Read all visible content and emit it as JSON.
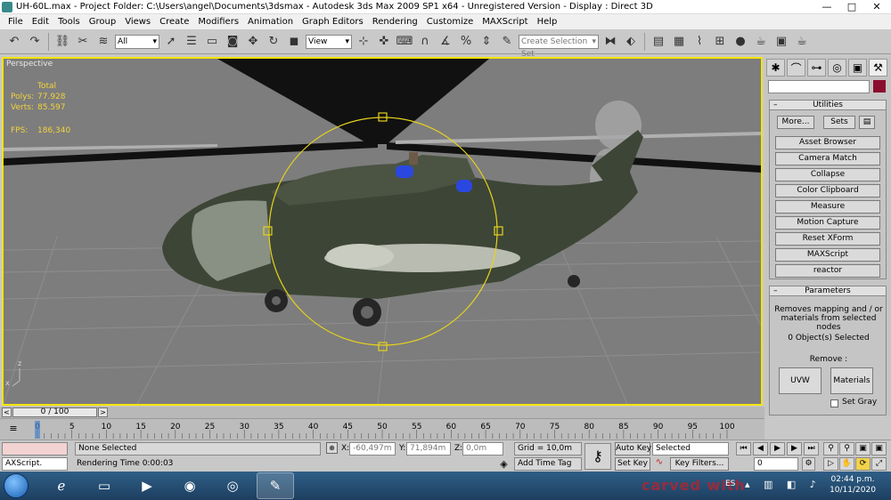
{
  "window": {
    "title": "UH-60L.max    - Project Folder: C:\\Users\\angel\\Documents\\3dsmax    - Autodesk 3ds Max  2009 SP1  x64    - Unregistered Version    - Display : Direct 3D",
    "buttons": [
      "—",
      "□",
      "✕"
    ]
  },
  "menu": [
    "File",
    "Edit",
    "Tools",
    "Group",
    "Views",
    "Create",
    "Modifiers",
    "Animation",
    "Graph Editors",
    "Rendering",
    "Customize",
    "MAXScript",
    "Help"
  ],
  "toolbar": {
    "selection_filter": "All",
    "reference_coord": "View",
    "named_selection_placeholder": "Create Selection Set",
    "icons": [
      "undo-icon",
      "redo-icon",
      "link-icon",
      "unlink-icon",
      "bind-space-warp-icon",
      "select-icon",
      "select-by-name-icon",
      "rect-region-icon",
      "window-crossing-icon",
      "move-icon",
      "rotate-icon",
      "scale-icon",
      "pivot-icon",
      "manipulate-icon",
      "keyboard-shortcut-icon",
      "snap-3d-icon",
      "angle-snap-icon",
      "percent-snap-icon",
      "spinner-snap-icon",
      "edit-named-sets-icon",
      "mirror-icon",
      "align-icon",
      "layer-manager-icon",
      "graphite-icon",
      "curve-editor-icon",
      "schematic-view-icon",
      "material-editor-icon",
      "render-setup-icon",
      "rendered-frame-icon",
      "quick-render-icon"
    ]
  },
  "viewport": {
    "label": "Perspective",
    "stats": {
      "header": "Total",
      "polys_label": "Polys:",
      "polys": "77.928",
      "verts_label": "Verts:",
      "verts": "85.597",
      "fps_label": "FPS:",
      "fps": "186,340"
    },
    "axis": {
      "z": "z",
      "x": "x"
    }
  },
  "command_panel": {
    "tabs": [
      "create-tab-icon",
      "modify-tab-icon",
      "hierarchy-tab-icon",
      "motion-tab-icon",
      "display-tab-icon",
      "utilities-tab-icon"
    ],
    "utilities": {
      "title": "Utilities",
      "more": "More...",
      "sets": "Sets",
      "buttons": [
        "Asset Browser",
        "Camera Match",
        "Collapse",
        "Color Clipboard",
        "Measure",
        "Motion Capture",
        "Reset XForm",
        "MAXScript",
        "reactor"
      ]
    },
    "parameters": {
      "title": "Parameters",
      "description": "Removes mapping and / or materials from selected nodes",
      "selected": "0 Object(s) Selected",
      "remove_label": "Remove :",
      "uvw": "UVW",
      "materials": "Materials",
      "set_gray": "Set Gray"
    }
  },
  "timeline": {
    "slider": "0 / 100",
    "ticks": [
      "0",
      "5",
      "10",
      "15",
      "20",
      "25",
      "30",
      "35",
      "40",
      "45",
      "50",
      "55",
      "60",
      "65",
      "70",
      "75",
      "80",
      "85",
      "90",
      "95",
      "100"
    ]
  },
  "status": {
    "listener": "AXScript.",
    "selection": "None Selected",
    "prompt": "Rendering Time  0:00:03",
    "x_label": "X:",
    "x": "-60,497m",
    "y_label": "Y:",
    "y": "71,894m",
    "z_label": "Z:",
    "z": "0,0m",
    "grid": "Grid = 10,0m",
    "add_time_tag": "Add Time Tag",
    "auto_key": "Auto Key",
    "set_key": "Set Key",
    "key_mode": "Selected",
    "key_filters": "Key Filters...",
    "frame": "0"
  },
  "taskbar": {
    "language": "ES",
    "time": "02:44 p.m.",
    "date": "10/11/2020",
    "watermark": "carved with"
  },
  "colors": {
    "viewport_bg": "#7d7d7d",
    "active_border": "#f5e400",
    "stat_text": "#f2d23c",
    "gizmo": "#e6d21c",
    "object_color": "#8b0e2e"
  }
}
